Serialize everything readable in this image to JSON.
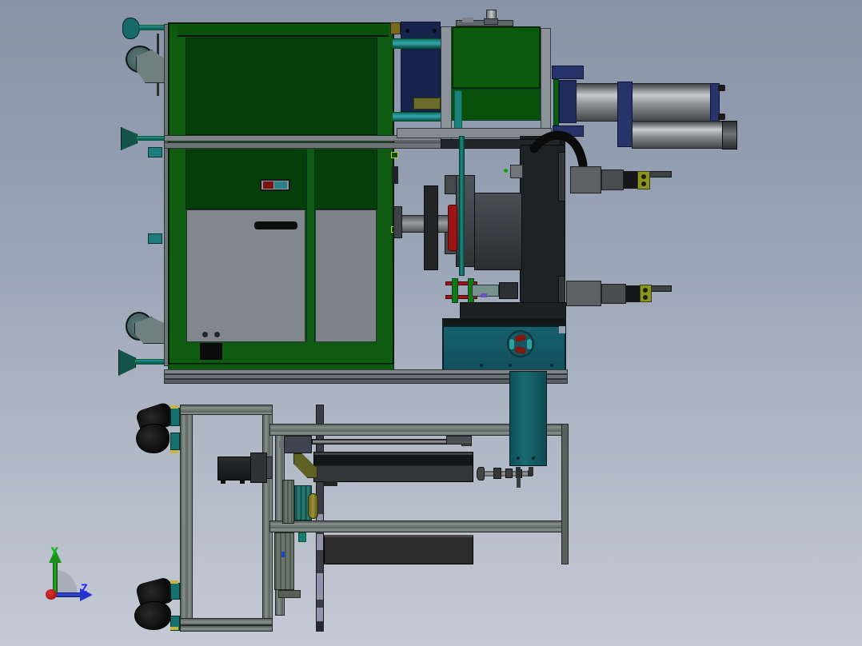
{
  "viewport": {
    "kind": "cad-3d-viewport",
    "background_top": "#8893a7",
    "background_bottom": "#c4cad5"
  },
  "triad": {
    "y_label": "Y",
    "z_label": "Z",
    "y_color": "#00c800",
    "z_color": "#2a2aff",
    "origin_color": "#cc1111"
  },
  "palette": {
    "cabinet_green": "#0d5a10",
    "panel_dark_green": "#05400a",
    "panel_gray": "#81888d",
    "teal": "#177070",
    "navy_block": "#1b2a52",
    "cylinder_gray": "#9fa3a6",
    "drum_gray": "#2b2e31",
    "coupling_red": "#9c1414",
    "sensor_yellow": "#8a941e",
    "control_box_teal": "#135561",
    "frame_gray_green": "#6e7974",
    "actuator_black": "#1c1e1f",
    "column_segment_light": "#9093aa",
    "indicator_red": "#7c1212",
    "indicator_teal": "#2a8086"
  }
}
